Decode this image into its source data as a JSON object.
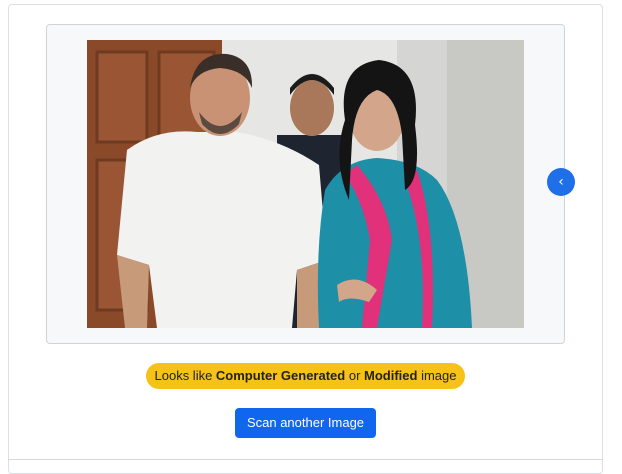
{
  "result": {
    "badge_prefix": "Looks like ",
    "badge_strong_1": "Computer Generated",
    "badge_middle": " or ",
    "badge_strong_2": "Modified",
    "badge_suffix": " image"
  },
  "actions": {
    "scan_again_label": "Scan another Image"
  },
  "carousel": {
    "prev_icon": "chevron-left-icon",
    "prev_glyph": "‹"
  },
  "colors": {
    "badge_bg": "#f7c217",
    "button_bg": "#1166ee",
    "carousel_bg": "#1f6fe8"
  }
}
